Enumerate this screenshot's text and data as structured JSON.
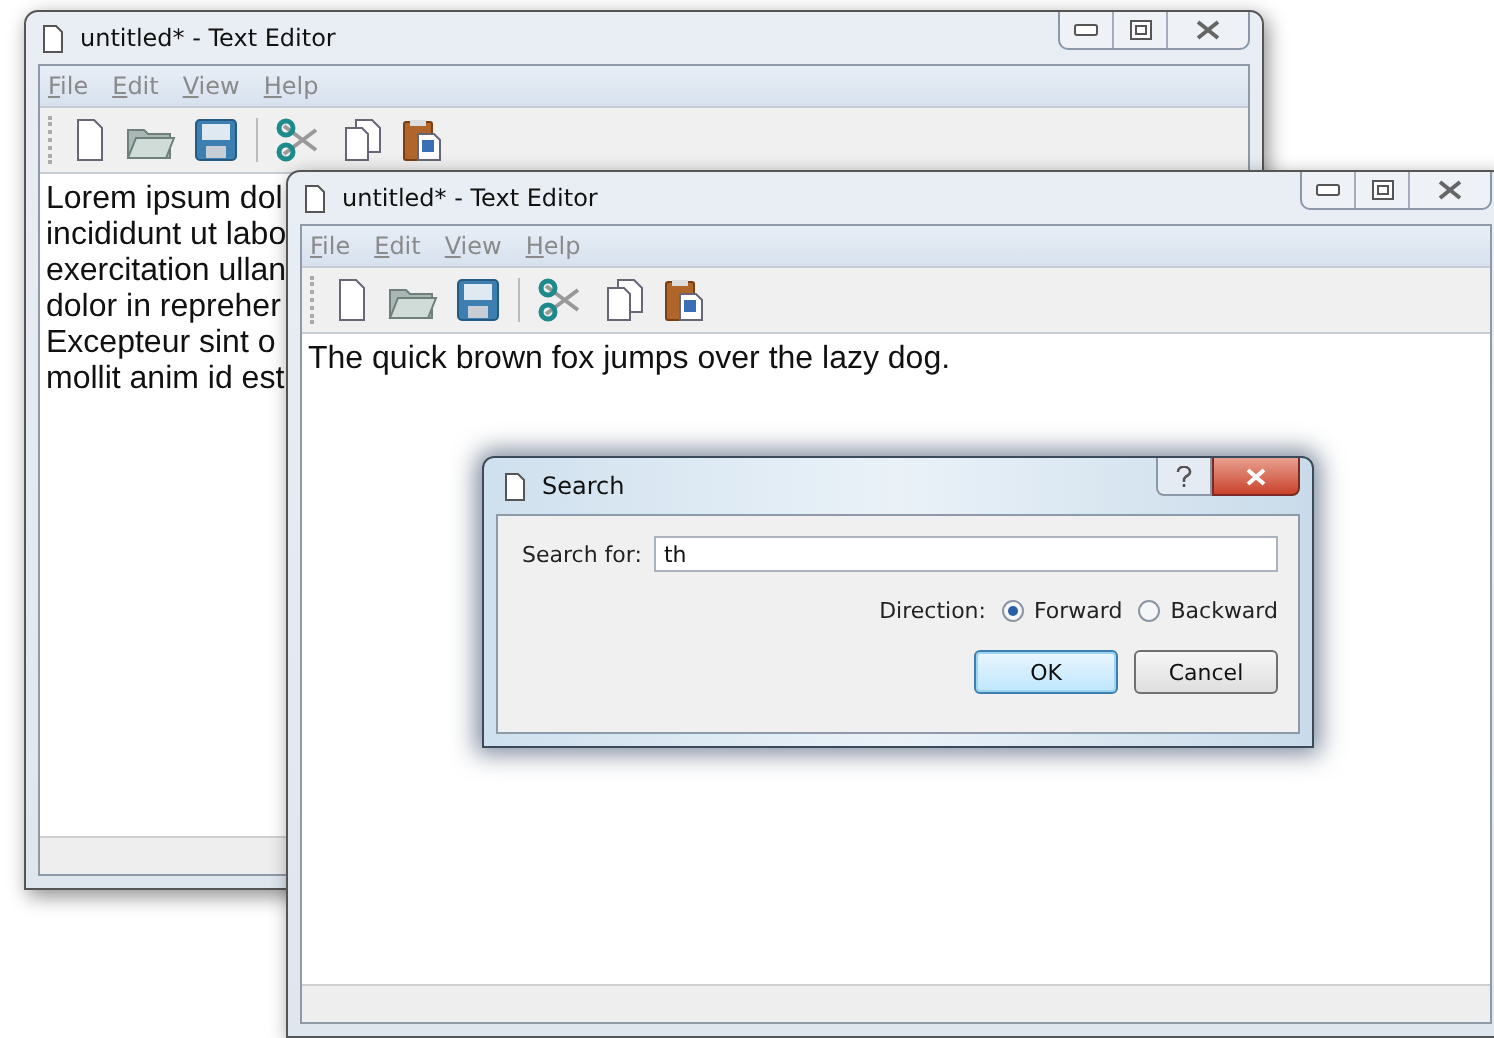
{
  "windows": [
    {
      "title": "untitled* - Text Editor",
      "menu": [
        "File",
        "Edit",
        "View",
        "Help"
      ],
      "text_lines": [
        "Lorem ipsum dol",
        "incididunt ut labo",
        "exercitation ullan",
        "dolor in repreher",
        "Excepteur sint o",
        "mollit anim id est"
      ]
    },
    {
      "title": "untitled* - Text Editor",
      "menu": [
        "File",
        "Edit",
        "View",
        "Help"
      ],
      "text_lines": [
        "The quick brown fox jumps over the lazy dog."
      ]
    }
  ],
  "dialog": {
    "title": "Search",
    "search_label": "Search for:",
    "search_value": "th",
    "direction_label": "Direction:",
    "directions": [
      {
        "label": "Forward",
        "selected": true
      },
      {
        "label": "Backward",
        "selected": false
      }
    ],
    "buttons": [
      {
        "label": "OK",
        "default": true
      },
      {
        "label": "Cancel",
        "default": false
      }
    ]
  }
}
